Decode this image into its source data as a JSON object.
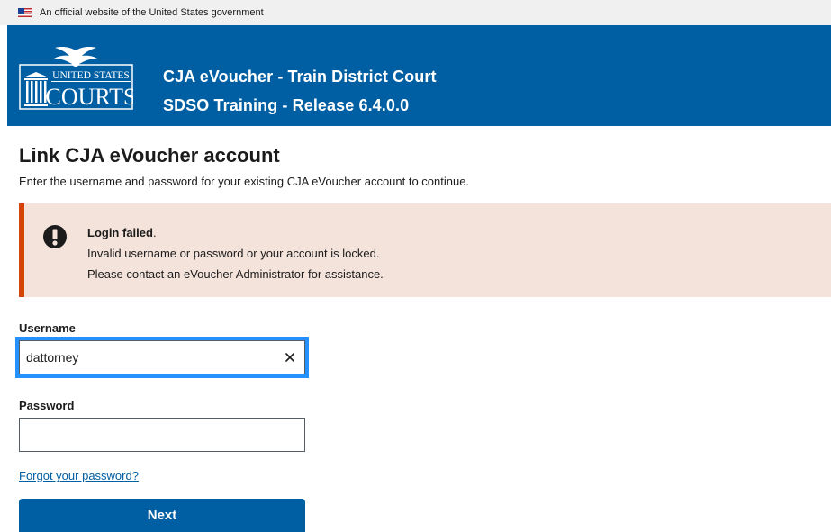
{
  "gov_banner": {
    "text": "An official website of the United States government",
    "flag_icon": "us-flag-icon"
  },
  "header": {
    "logo_top": "UNITED STATES",
    "logo_bottom": "COURTS",
    "logo_icon": "us-courts-eagle-logo",
    "title": "CJA eVoucher - Train District Court",
    "subtitle": "SDSO Training - Release 6.4.0.0",
    "background_color": "#005ea2"
  },
  "main": {
    "title": "Link CJA eVoucher account",
    "intro": "Enter the username and password for your existing CJA eVoucher account to continue."
  },
  "alert": {
    "type": "error",
    "icon": "exclamation-circle-icon",
    "heading": "Login failed",
    "heading_suffix": ".",
    "line1": "Invalid username or password or your account is locked.",
    "line2": "Please contact an eVoucher Administrator for assistance.",
    "background_color": "#f4e3db",
    "border_color": "#d54309"
  },
  "form": {
    "username_label": "Username",
    "username_value": "dattorney",
    "clear_icon": "close-icon",
    "password_label": "Password",
    "password_value": "",
    "forgot_link": "Forgot your password?",
    "next_label": "Next",
    "focus_color": "#2491ff"
  }
}
